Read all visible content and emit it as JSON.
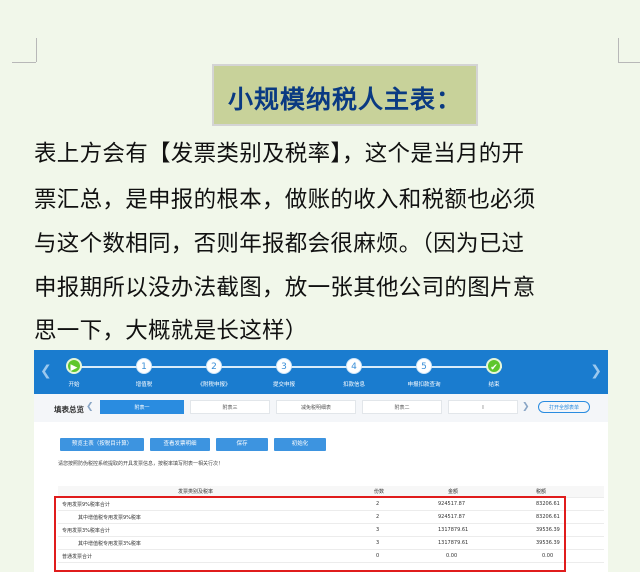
{
  "heading": "小规模纳税人主表：",
  "paragraph_lines": [
    "表上方会有【发票类别及税率】，这个是当月的开",
    "票汇总，是申报的根本，做账的收入和税额也必须",
    "与这个数相同，否则年报都会很麻烦。（因为已过",
    "申报期所以没办法截图，放一张其他公司的图片意",
    "思一下，大概就是长这样）"
  ],
  "screenshot": {
    "steps": [
      {
        "num": "▶",
        "label": "开始",
        "done": true
      },
      {
        "num": "1",
        "label": "增值税",
        "done": false
      },
      {
        "num": "2",
        "label": "《附税申报》",
        "done": false
      },
      {
        "num": "3",
        "label": "提交申报",
        "done": false
      },
      {
        "num": "4",
        "label": "扣款信息",
        "done": false
      },
      {
        "num": "5",
        "label": "申报扣款查询",
        "done": false
      },
      {
        "num": "✔",
        "label": "结束",
        "done": true
      }
    ],
    "form_title": "填表总览",
    "tabs": [
      "附表一",
      "附表三",
      "减免税明细表",
      "附表二",
      "I"
    ],
    "open_all_label": "打开全部表单",
    "toolbar_buttons": [
      "预览主表（按税目计算）",
      "查看发票明细",
      "保存",
      "初始化"
    ],
    "hint_text": "请您按照防伪税控系统提取的开具发票信息，按税率填写附表一相关行次！",
    "table": {
      "headers": [
        "发票类别及税率",
        "份数",
        "金额",
        "税额"
      ],
      "rows": [
        [
          "专用发票9%税率合计",
          "2",
          "924517.87",
          "83206.61"
        ],
        [
          "其中增值税专用发票9%税率",
          "2",
          "924517.87",
          "83206.61"
        ],
        [
          "专用发票3%税率合计",
          "3",
          "1317879.61",
          "39536.39"
        ],
        [
          "其中增值税专用发票3%税率",
          "3",
          "1317879.61",
          "39536.39"
        ],
        [
          "普通发票合计",
          "0",
          "0.00",
          "0.00"
        ]
      ]
    }
  }
}
